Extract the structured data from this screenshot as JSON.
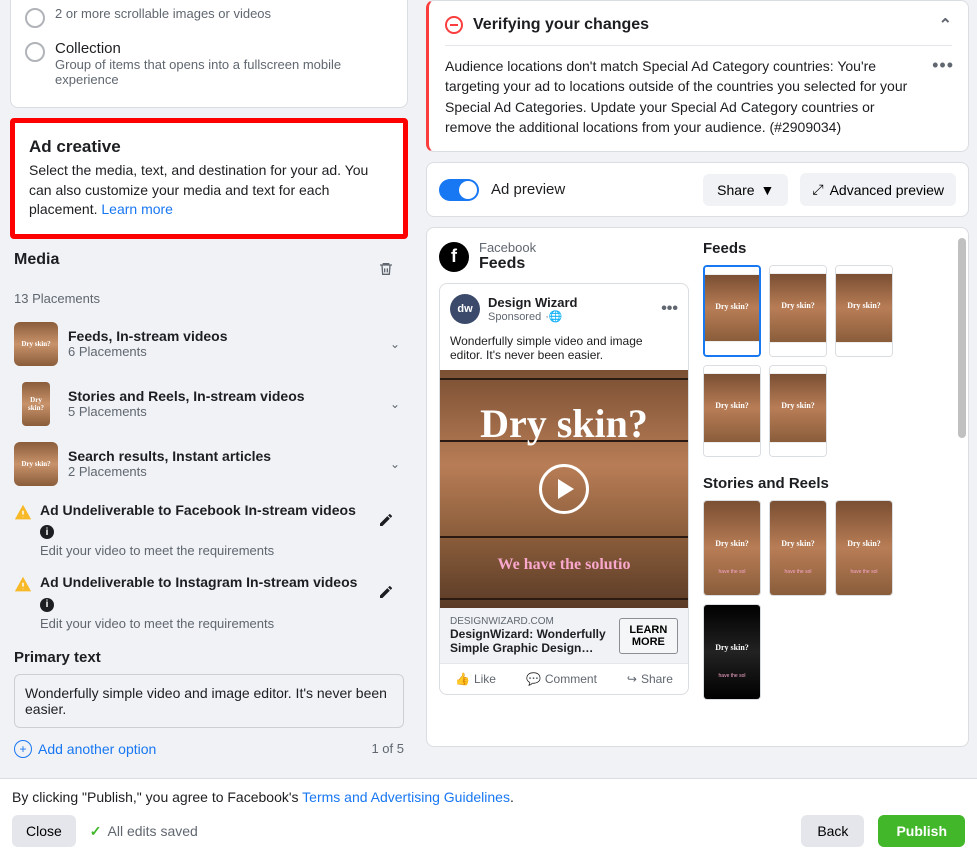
{
  "format_options": [
    {
      "title": "",
      "sub": "2 or more scrollable images or videos"
    },
    {
      "title": "Collection",
      "sub": "Group of items that opens into a fullscreen mobile experience"
    }
  ],
  "creative": {
    "title": "Ad creative",
    "desc": "Select the media, text, and destination for your ad. You can also customize your media and text for each placement.",
    "learn": "Learn more"
  },
  "media": {
    "title": "Media",
    "count": "13 Placements",
    "groups": [
      {
        "title": "Feeds, In-stream videos",
        "sub": "6 Placements"
      },
      {
        "title": "Stories and Reels, In-stream videos",
        "sub": "5 Placements"
      },
      {
        "title": "Search results, Instant articles",
        "sub": "2 Placements"
      }
    ],
    "warnings": [
      {
        "title": "Ad Undeliverable to Facebook In-stream videos",
        "sub": "Edit your video to meet the requirements"
      },
      {
        "title": "Ad Undeliverable to Instagram In-stream videos",
        "sub": "Edit your video to meet the requirements"
      }
    ],
    "primary_label": "Primary text",
    "primary_text": "Wonderfully simple video and image editor. It's never been easier.",
    "add_option": "Add another option",
    "counter": "1 of 5"
  },
  "alert": {
    "title": "Verifying your changes",
    "body": "Audience locations don't match Special Ad Category countries: You're targeting your ad to locations outside of the countries you selected for your Special Ad Categories. Update your Special Ad Category countries or remove the additional locations from your audience. (#2909034)"
  },
  "preview_bar": {
    "label": "Ad preview",
    "share": "Share",
    "advanced": "Advanced preview"
  },
  "preview": {
    "platform": "Facebook",
    "feed": "Feeds",
    "post_name": "Design Wizard",
    "sponsored": "Sponsored",
    "post_body": "Wonderfully simple video and image editor. It's never been easier.",
    "img_text1": "Dry skin?",
    "img_text2": "We have the solutio",
    "domain": "DESIGNWIZARD.COM",
    "cta_title": "DesignWizard: Wonderfully Simple Graphic Design…",
    "cta_btn": "LEARN MORE",
    "like": "Like",
    "comment": "Comment",
    "share_action": "Share",
    "stories_title": "Stories and Reels",
    "feeds_title": "Feeds"
  },
  "footer": {
    "disclaimer_pre": "By clicking \"Publish,\" you agree to Facebook's ",
    "disclaimer_link": "Terms and Advertising Guidelines",
    "close": "Close",
    "saved": "All edits saved",
    "back": "Back",
    "publish": "Publish"
  }
}
